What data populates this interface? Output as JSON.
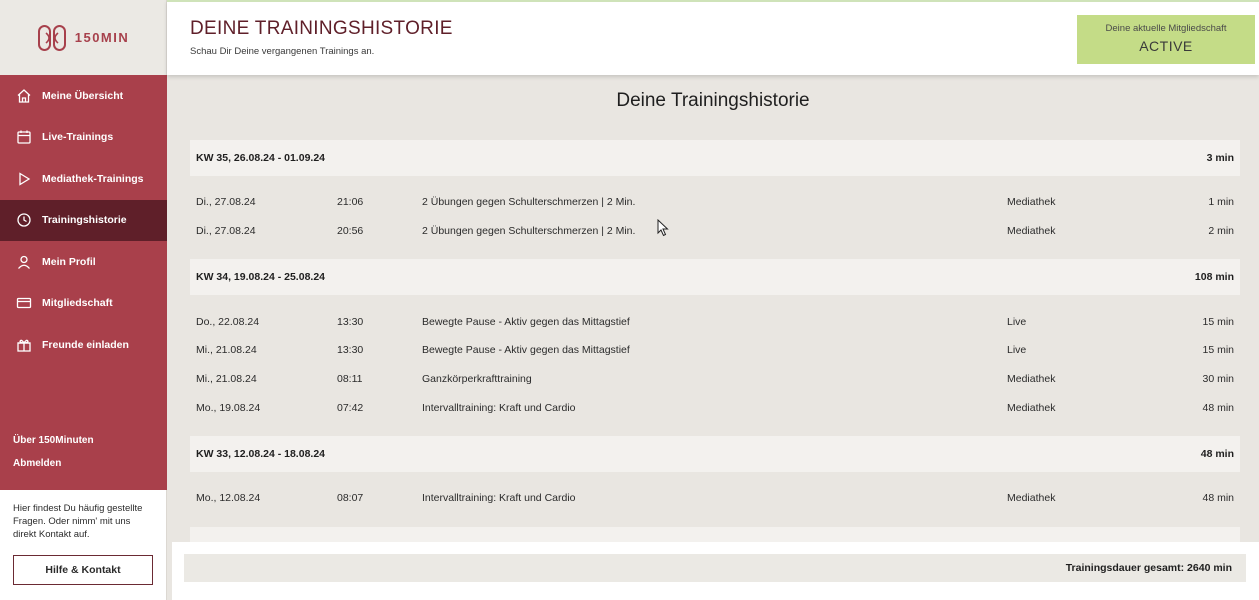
{
  "brand": {
    "name": "150MIN"
  },
  "sidebar": {
    "items": [
      {
        "label": "Meine Übersicht",
        "icon": "home-icon",
        "active": false
      },
      {
        "label": "Live-Trainings",
        "icon": "calendar-icon",
        "active": false
      },
      {
        "label": "Mediathek-Trainings",
        "icon": "play-icon",
        "active": false
      },
      {
        "label": "Trainingshistorie",
        "icon": "clock-icon",
        "active": true
      },
      {
        "label": "Mein Profil",
        "icon": "user-icon",
        "active": false
      },
      {
        "label": "Mitgliedschaft",
        "icon": "card-icon",
        "active": false
      },
      {
        "label": "Freunde einladen",
        "icon": "gift-icon",
        "active": false
      }
    ],
    "about_label": "Über 150Minuten",
    "logout_label": "Abmelden",
    "help_text": "Hier findest Du häufig gestellte Fragen. Oder nimm' mit uns direkt Kontakt auf.",
    "help_button": "Hilfe & Kontakt"
  },
  "header": {
    "title": "DEINE TRAININGSHISTORIE",
    "subtitle": "Schau Dir Deine vergangenen Trainings an.",
    "membership_label": "Deine aktuelle Mitgliedschaft",
    "membership_status": "ACTIVE"
  },
  "main": {
    "title": "Deine Trainingshistorie",
    "weeks": [
      {
        "label": "KW 35, 26.08.24 - 01.09.24",
        "total": "3 min",
        "rows": [
          {
            "date": "Di., 27.08.24",
            "time": "21:06",
            "title": "2 Übungen gegen Schulterschmerzen | 2 Min.",
            "type": "Mediathek",
            "duration": "1 min"
          },
          {
            "date": "Di., 27.08.24",
            "time": "20:56",
            "title": "2 Übungen gegen Schulterschmerzen | 2 Min.",
            "type": "Mediathek",
            "duration": "2 min"
          }
        ]
      },
      {
        "label": "KW 34, 19.08.24 - 25.08.24",
        "total": "108 min",
        "rows": [
          {
            "date": "Do., 22.08.24",
            "time": "13:30",
            "title": "Bewegte Pause - Aktiv gegen das Mittagstief",
            "type": "Live",
            "duration": "15 min"
          },
          {
            "date": "Mi., 21.08.24",
            "time": "13:30",
            "title": "Bewegte Pause - Aktiv gegen das Mittagstief",
            "type": "Live",
            "duration": "15 min"
          },
          {
            "date": "Mi., 21.08.24",
            "time": "08:11",
            "title": "Ganzkörperkrafttraining",
            "type": "Mediathek",
            "duration": "30 min"
          },
          {
            "date": "Mo., 19.08.24",
            "time": "07:42",
            "title": "Intervalltraining: Kraft und Cardio",
            "type": "Mediathek",
            "duration": "48 min"
          }
        ]
      },
      {
        "label": "KW 33, 12.08.24 - 18.08.24",
        "total": "48 min",
        "rows": [
          {
            "date": "Mo., 12.08.24",
            "time": "08:07",
            "title": "Intervalltraining: Kraft und Cardio",
            "type": "Mediathek",
            "duration": "48 min"
          }
        ]
      }
    ],
    "total_label": "Trainingsdauer gesamt: 2640 min"
  }
}
